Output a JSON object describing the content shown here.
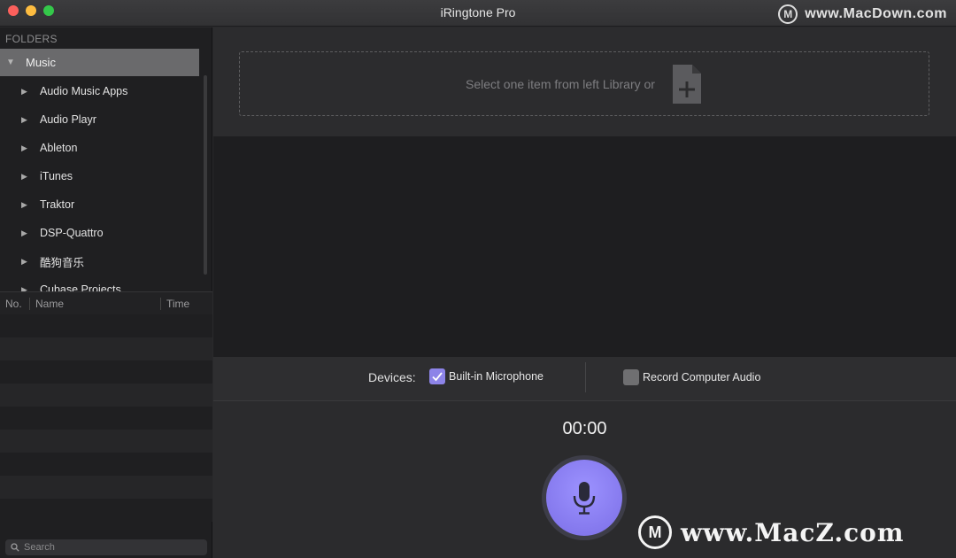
{
  "window": {
    "title": "iRingtone Pro",
    "watermark_top": "www.MacDown.com",
    "watermark_bottom": "www.MacZ.com"
  },
  "sidebar": {
    "section_label": "FOLDERS",
    "root": {
      "label": "Music",
      "expanded": true
    },
    "items": [
      {
        "label": "Audio Music Apps"
      },
      {
        "label": "Audio Playr"
      },
      {
        "label": "Ableton"
      },
      {
        "label": "iTunes"
      },
      {
        "label": "Traktor"
      },
      {
        "label": "DSP-Quattro"
      },
      {
        "label": "酷狗音乐"
      },
      {
        "label": "Cubase Projects"
      }
    ],
    "table": {
      "columns": [
        "No.",
        "Name",
        "Time"
      ],
      "rows": []
    },
    "search": {
      "placeholder": "Search",
      "value": ""
    }
  },
  "main": {
    "drop_zone_text": "Select one item from left Library or",
    "devices": {
      "label": "Devices:",
      "options": [
        {
          "label": "Built-in Microphone",
          "checked": true
        },
        {
          "label": "Record Computer Audio",
          "checked": false
        }
      ]
    },
    "timer": "00:00"
  },
  "colors": {
    "accent": "#8d84e8",
    "record_button": "#8a7ff5",
    "selected_row": "#6a6a6c"
  },
  "icons": {
    "add_file": "add-file-icon",
    "record": "microphone-icon",
    "search": "search-icon"
  }
}
